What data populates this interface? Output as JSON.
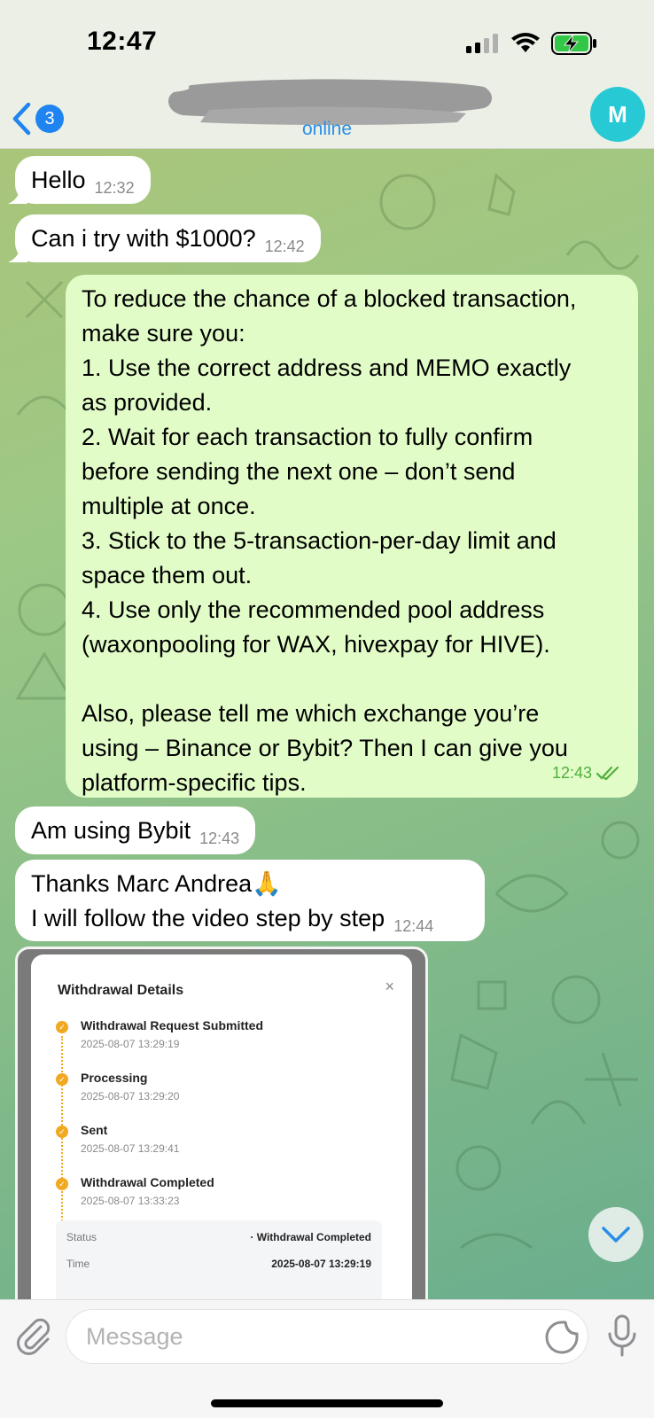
{
  "status_bar": {
    "time": "12:47"
  },
  "header": {
    "back_count": "3",
    "status": "online",
    "avatar_initial": "M"
  },
  "messages": [
    {
      "direction": "in",
      "text": "Hello",
      "time": "12:32"
    },
    {
      "direction": "in",
      "text": "Can i try with $1000?",
      "time": "12:42"
    },
    {
      "direction": "out",
      "lines": [
        "To reduce the chance of a blocked transaction,",
        "make sure you:",
        "1. Use the correct address and MEMO exactly",
        "as provided.",
        "2. Wait for each transaction to fully confirm",
        "before sending the next one – don’t send",
        "multiple at once.",
        "3. Stick to the 5-transaction-per-day limit and",
        "space them out.",
        "4. Use only the recommended pool address",
        "(waxonpooling for WAX, hivexpay for HIVE).",
        "",
        "Also, please tell me which exchange you’re",
        "using – Binance or Bybit? Then I can give you",
        "platform-specific tips."
      ],
      "time": "12:43",
      "read": true
    },
    {
      "direction": "in",
      "text": "Am using Bybit",
      "time": "12:43"
    },
    {
      "direction": "in",
      "lines": [
        "Thanks Marc Andrea🙏",
        "I will follow the video step by step"
      ],
      "time": "12:44"
    }
  ],
  "withdrawal_image": {
    "title": "Withdrawal Details",
    "close": "×",
    "steps": [
      {
        "name": "Withdrawal Request Submitted",
        "time": "2025-08-07 13:29:19"
      },
      {
        "name": "Processing",
        "time": "2025-08-07 13:29:20"
      },
      {
        "name": "Sent",
        "time": "2025-08-07 13:29:41"
      },
      {
        "name": "Withdrawal Completed",
        "time": "2025-08-07 13:33:23"
      }
    ],
    "table": [
      {
        "key": "Status",
        "value": "· Withdrawal Completed"
      },
      {
        "key": "Time",
        "value": "2025-08-07 13:29:19"
      }
    ]
  },
  "input": {
    "placeholder": "Message"
  },
  "colors": {
    "accent": "#1f84f0",
    "avatar": "#27c9d4",
    "outgoing_bubble": "#e2fcc8",
    "read_check": "#4faf3a"
  }
}
